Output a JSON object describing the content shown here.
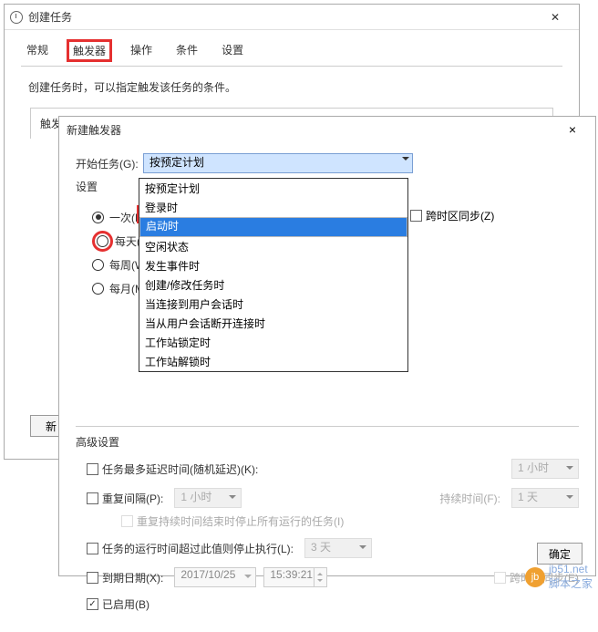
{
  "parent": {
    "title": "创建任务",
    "tabs": [
      "常规",
      "触发器",
      "操作",
      "条件",
      "设置"
    ],
    "active_tab_index": 1,
    "description": "创建任务时，可以指定触发该任务的条件。",
    "list_header": "触发",
    "new_button": "新"
  },
  "dialog": {
    "title": "新建触发器",
    "close_glyph": "×",
    "start_label": "开始任务(G):",
    "settings_label": "设置",
    "combo_value": "按预定计划",
    "dropdown_items": [
      "按预定计划",
      "登录时",
      "启动时",
      "空闲状态",
      "发生事件时",
      "创建/修改任务时",
      "当连接到用户会话时",
      "当从用户会话断开连接时",
      "工作站锁定时",
      "工作站解锁时"
    ],
    "selected_item_index": 2,
    "radios": {
      "once": "一次(N",
      "daily": "每天(D)",
      "weekly": "每周(W)",
      "monthly": "每月(M)"
    },
    "sync_tz": "跨时区同步(Z)",
    "advanced": {
      "title": "高级设置",
      "delay_label": "任务最多延迟时间(随机延迟)(K):",
      "delay_value": "1 小时",
      "repeat_label": "重复间隔(P):",
      "repeat_value": "1 小时",
      "duration_label": "持续时间(F):",
      "duration_value": "1 天",
      "repeat_end_label": "重复持续时间结束时停止所有运行的任务(I)",
      "stop_label": "任务的运行时间超过此值则停止执行(L):",
      "stop_value": "3 天",
      "expire_label": "到期日期(X):",
      "expire_date": "2017/10/25",
      "expire_time": "15:39:21",
      "expire_sync": "跨时区同步(E)",
      "enabled_label": "已启用(B)"
    },
    "ok_button": "确定"
  },
  "watermark": {
    "site": "jb51.net",
    "name": "脚本之家"
  }
}
